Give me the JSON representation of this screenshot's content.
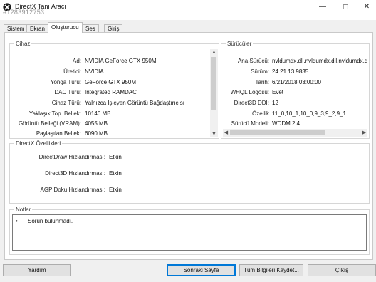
{
  "window": {
    "title": "DirectX Tanı Aracı",
    "overlay_id": "#1283912753",
    "minimize_glyph": "—",
    "maximize_glyph": "☐",
    "close_glyph": "✕"
  },
  "tabs": [
    {
      "label": "Sistem"
    },
    {
      "label": "Ekran"
    },
    {
      "label": "Oluşturucu"
    },
    {
      "label": "Ses"
    },
    {
      "label": "Giriş"
    }
  ],
  "active_tab": "Oluşturucu",
  "device": {
    "heading": "Cihaz",
    "rows": [
      {
        "label": "Ad:",
        "value": "NVIDIA GeForce GTX 950M"
      },
      {
        "label": "Üretici:",
        "value": "NVIDIA"
      },
      {
        "label": "Yonga Türü:",
        "value": "GeForce GTX 950M"
      },
      {
        "label": "DAC Türü:",
        "value": "Integrated RAMDAC"
      },
      {
        "label": "Cihaz Türü:",
        "value": "Yalnızca İşleyen Görüntü Bağdaştırıcısı"
      },
      {
        "label": "Yaklaşık Top. Bellek:",
        "value": "10146 MB"
      },
      {
        "label": "Görüntü Belleği (VRAM):",
        "value": "4055 MB"
      },
      {
        "label": "Paylaşılan Bellek:",
        "value": "6090 MB"
      }
    ]
  },
  "drivers": {
    "heading": "Sürücüler",
    "rows": [
      {
        "label": "Ana Sürücü:",
        "value": "nvldumdx.dll,nvldumdx.dll,nvldumdx.dll"
      },
      {
        "label": "Sürüm:",
        "value": "24.21.13.9835"
      },
      {
        "label": "Tarih:",
        "value": "6/21/2018 03:00:00"
      },
      {
        "label": "WHQL Logosu:",
        "value": "Evet"
      },
      {
        "label": "Direct3D DDI:",
        "value": "12"
      },
      {
        "label": "Özellik",
        "value": "11_0,10_1,10_0,9_3,9_2,9_1"
      },
      {
        "label": "Sürücü Modeli:",
        "value": "WDDM 2.4"
      }
    ]
  },
  "directx": {
    "heading": "DirectX Özellikleri",
    "rows": [
      {
        "label": "DirectDraw Hızlandırması:",
        "value": "Etkin"
      },
      {
        "label": "Direct3D Hızlandırması:",
        "value": "Etkin"
      },
      {
        "label": "AGP Doku Hızlandırması:",
        "value": "Etkin"
      }
    ]
  },
  "notes": {
    "heading": "Notlar",
    "bullet": "•",
    "items": [
      "Sorun bulunmadı."
    ]
  },
  "buttons": {
    "help": "Yardım",
    "next_page": "Sonraki Sayfa",
    "save_all": "Tüm Bilgileri Kaydet...",
    "exit": "Çıkış"
  },
  "colors": {
    "accent": "#0078d7",
    "panel": "#ffffff",
    "window_bg": "#f0f0f0"
  },
  "icons": {
    "app": "directx-x-icon",
    "scroll_up": "▲",
    "scroll_down": "▼",
    "scroll_left": "◀",
    "scroll_right": "▶"
  }
}
